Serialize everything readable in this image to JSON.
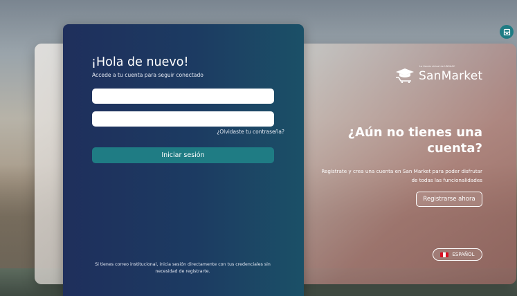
{
  "login": {
    "title": "¡Hola de nuevo!",
    "subtitle": "Accede a tu cuenta para seguir conectado",
    "username_value": "",
    "password_value": "",
    "forgot_link": "¿Olvidaste tu contraseña?",
    "submit_label": "Iniciar sesión",
    "footer_note": "Si tienes correo institucional, inicia sesión directamente con tus credenciales sin necesidad de registrarte."
  },
  "brand": {
    "name": "SanMarket",
    "tagline": "La tienda virtual de UNSAAC",
    "logo_icon": "graduation-cap-cart-icon"
  },
  "signup": {
    "headline": "¿Aún no tienes una cuenta?",
    "description": "Regístrate y crea una cuenta en San Market para poder disfrutar de todas las funcionalidades",
    "button_label": "Registrarse ahora"
  },
  "language": {
    "selected": "ESPAÑOL",
    "flag_icon": "peru-flag-icon"
  },
  "corner_button": {
    "icon": "store-icon"
  },
  "colors": {
    "panel_start": "#1f2f5c",
    "panel_end": "#1b5067",
    "accent": "#1f7c84"
  }
}
